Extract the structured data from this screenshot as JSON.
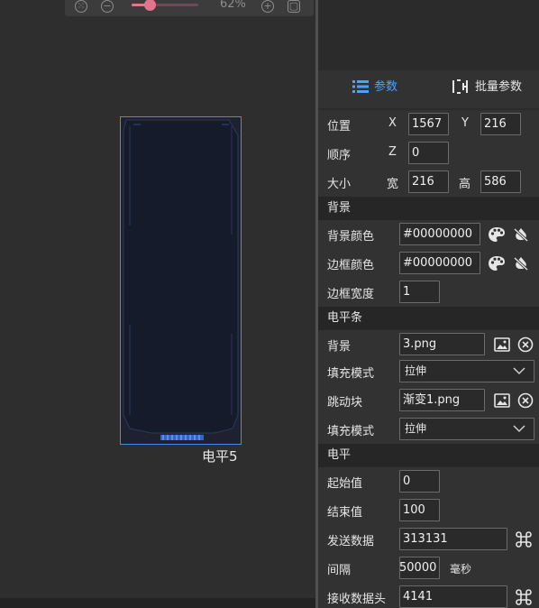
{
  "zoom": {
    "level_text": "62%",
    "level": 0.62
  },
  "canvas": {
    "element_label": "电平5",
    "frame_color": "#3f8fe8"
  },
  "tabs": [
    {
      "label": "参数",
      "active": true
    },
    {
      "label": "批量参数",
      "active": false
    }
  ],
  "layout": {
    "position_label": "位置",
    "x_label": "X",
    "x_value": "1567",
    "y_label": "Y",
    "y_value": "216",
    "order_label": "顺序",
    "z_label": "Z",
    "z_value": "0",
    "size_label": "大小",
    "w_label": "宽",
    "w_value": "216",
    "h_label": "高",
    "h_value": "586"
  },
  "background": {
    "header": "背景",
    "bg_color_label": "背景颜色",
    "bg_color_value": "#00000000",
    "border_color_label": "边框颜色",
    "border_color_value": "#00000000",
    "border_width_label": "边框宽度",
    "border_width_value": "1"
  },
  "level_bar": {
    "header": "电平条",
    "bg_label": "背景",
    "bg_value": "3.png",
    "fill_mode_label": "填充模式",
    "fill_mode_value": "拉伸",
    "jump_block_label": "跳动块",
    "jump_block_value": "渐变1.png",
    "fill_mode2_label": "填充模式",
    "fill_mode2_value": "拉伸"
  },
  "level": {
    "header": "电平",
    "start_label": "起始值",
    "start_value": "0",
    "end_label": "结束值",
    "end_value": "100",
    "send_label": "发送数据",
    "send_value": "313131",
    "interval_label": "间隔",
    "interval_value": "50000",
    "interval_unit": "毫秒",
    "recv_label": "接收数据头",
    "recv_value": "4141"
  },
  "icons": {
    "palette": "palette-icon",
    "clear": "clear-color-icon",
    "image": "image-icon",
    "remove": "remove-icon",
    "command": "command-icon",
    "list": "list-icon",
    "batch": "batch-params-icon",
    "zoom_fit": "fit-icon",
    "zoom_out": "zoom-out-icon",
    "zoom_in": "zoom-in-icon",
    "fullscreen": "fullscreen-icon"
  },
  "colors": {
    "accent": "#4aa3ff",
    "slider": "#e2748c"
  }
}
